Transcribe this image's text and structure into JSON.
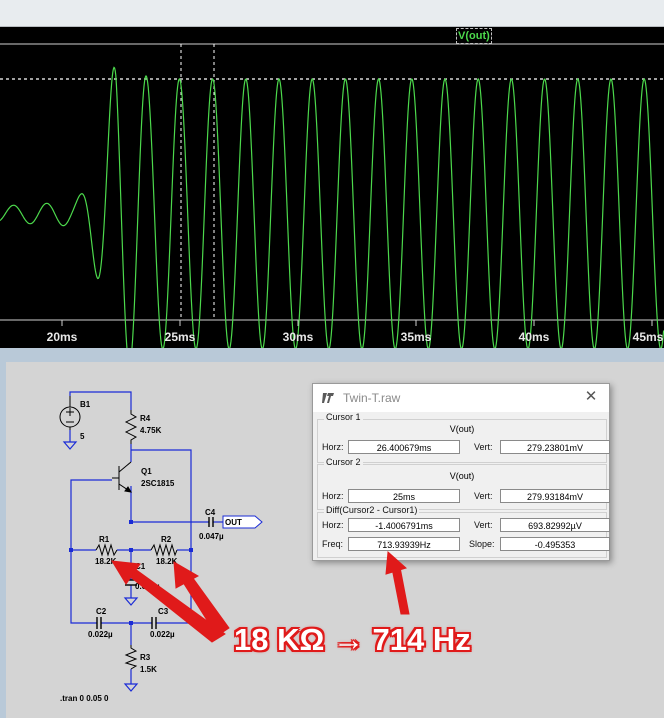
{
  "waveform": {
    "trace_label": "V(out)",
    "trace_color": "#4cd94c",
    "cursor_color": "#ffffff",
    "background": "#000000",
    "x_ticks": [
      "20ms",
      "25ms",
      "30ms",
      "35ms",
      "40ms",
      "45ms"
    ]
  },
  "schematic": {
    "components": {
      "b1_name": "B1",
      "b1_value": "5",
      "r4_name": "R4",
      "r4_value": "4.75K",
      "q1_name": "Q1",
      "q1_value": "2SC1815",
      "c4_name": "C4",
      "c4_value": "0.047µ",
      "out_label": "OUT",
      "r1_name": "R1",
      "r1_value": "18.2K",
      "r2_name": "R2",
      "r2_value": "18.2K",
      "c1_name": "C1",
      "c1_value": "0.047µ",
      "c2_name": "C2",
      "c2_value": "0.022µ",
      "c3_name": "C3",
      "c3_value": "0.022µ",
      "r3_name": "R3",
      "r3_value": "1.5K"
    },
    "directive": ".tran 0 0.05 0"
  },
  "dialog": {
    "title": "Twin-T.raw",
    "cursor1": {
      "group": "Cursor 1",
      "signal": "V(out)",
      "horz_label": "Horz:",
      "horz": "26.400679ms",
      "vert_label": "Vert:",
      "vert": "279.23801mV"
    },
    "cursor2": {
      "group": "Cursor 2",
      "signal": "V(out)",
      "horz_label": "Horz:",
      "horz": "25ms",
      "vert_label": "Vert:",
      "vert": "279.93184mV"
    },
    "diff": {
      "group": "Diff(Cursor2 - Cursor1)",
      "horz_label": "Horz:",
      "horz": "-1.4006791ms",
      "vert_label": "Vert:",
      "vert": "693.82992µV",
      "freq_label": "Freq:",
      "freq": "713.93939Hz",
      "slope_label": "Slope:",
      "slope": "-0.495353"
    }
  },
  "annotation": {
    "text": "18 KΩ → 714 Hz",
    "color": "#e01a1a"
  }
}
